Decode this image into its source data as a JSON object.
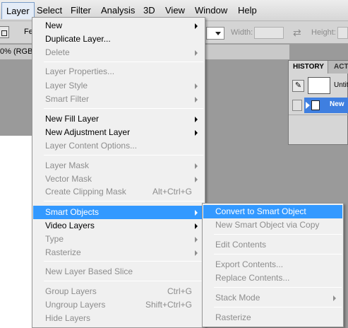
{
  "menubar": {
    "items": [
      "Layer",
      "Select",
      "Filter",
      "Analysis",
      "3D",
      "View",
      "Window",
      "Help"
    ]
  },
  "options": {
    "feather_label": "Fe",
    "width_label": "Width:",
    "height_label": "Height:"
  },
  "document_tab": {
    "label": "0% (RGB/"
  },
  "history_panel": {
    "tabs": [
      "HISTORY",
      "ACT"
    ],
    "snapshot_label": "Untit",
    "state_label": "New"
  },
  "layer_menu": {
    "items": [
      {
        "label": "New",
        "submenu": true
      },
      {
        "label": "Duplicate Layer..."
      },
      {
        "label": "Delete",
        "submenu": true,
        "disabled": true
      },
      {
        "label": "Layer Properties...",
        "disabled": true
      },
      {
        "label": "Layer Style",
        "submenu": true,
        "disabled": true
      },
      {
        "label": "Smart Filter",
        "submenu": true,
        "disabled": true
      },
      {
        "label": "New Fill Layer",
        "submenu": true
      },
      {
        "label": "New Adjustment Layer",
        "submenu": true
      },
      {
        "label": "Layer Content Options...",
        "disabled": true
      },
      {
        "label": "Layer Mask",
        "submenu": true,
        "disabled": true
      },
      {
        "label": "Vector Mask",
        "submenu": true,
        "disabled": true
      },
      {
        "label": "Create Clipping Mask",
        "shortcut": "Alt+Ctrl+G",
        "disabled": true
      },
      {
        "label": "Smart Objects",
        "submenu": true,
        "highlighted": true
      },
      {
        "label": "Video Layers",
        "submenu": true
      },
      {
        "label": "Type",
        "submenu": true,
        "disabled": true
      },
      {
        "label": "Rasterize",
        "submenu": true,
        "disabled": true
      },
      {
        "label": "New Layer Based Slice",
        "disabled": true
      },
      {
        "label": "Group Layers",
        "shortcut": "Ctrl+G",
        "disabled": true
      },
      {
        "label": "Ungroup Layers",
        "shortcut": "Shift+Ctrl+G",
        "disabled": true
      },
      {
        "label": "Hide Layers",
        "disabled": true
      }
    ]
  },
  "smart_objects_menu": {
    "items": [
      {
        "label": "Convert to Smart Object",
        "highlighted": true
      },
      {
        "label": "New Smart Object via Copy",
        "disabled": true
      },
      {
        "label": "Edit Contents",
        "disabled": true
      },
      {
        "label": "Export Contents...",
        "disabled": true
      },
      {
        "label": "Replace Contents...",
        "disabled": true
      },
      {
        "label": "Stack Mode",
        "submenu": true,
        "disabled": true
      },
      {
        "label": "Rasterize",
        "disabled": true
      }
    ]
  },
  "colors": {
    "highlight": "#3399ff",
    "history_selection": "#3f7fe0",
    "disabled_text": "#8d8d8d"
  }
}
